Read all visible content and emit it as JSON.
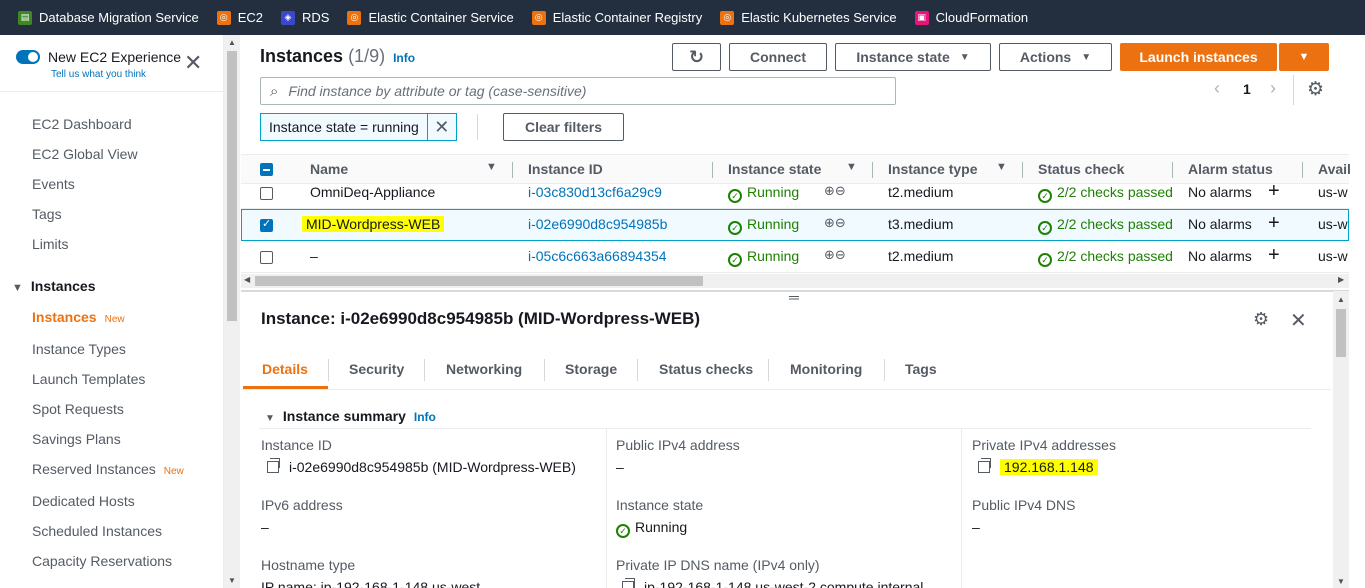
{
  "favorites": [
    {
      "label": "Database Migration Service",
      "color": "#3f8624"
    },
    {
      "label": "EC2",
      "color": "#ec7211"
    },
    {
      "label": "RDS",
      "color": "#3b48cc"
    },
    {
      "label": "Elastic Container Service",
      "color": "#ec7211"
    },
    {
      "label": "Elastic Container Registry",
      "color": "#ec7211"
    },
    {
      "label": "Elastic Kubernetes Service",
      "color": "#ec7211"
    },
    {
      "label": "CloudFormation",
      "color": "#e7157b"
    }
  ],
  "sidebar": {
    "new_experience": "New EC2 Experience",
    "tell_us": "Tell us what you think",
    "items": [
      "EC2 Dashboard",
      "EC2 Global View",
      "Events",
      "Tags",
      "Limits"
    ],
    "section": "Instances",
    "section_items": [
      {
        "label": "Instances",
        "badge": "New"
      },
      {
        "label": "Instance Types",
        "badge": ""
      },
      {
        "label": "Launch Templates",
        "badge": ""
      },
      {
        "label": "Spot Requests",
        "badge": ""
      },
      {
        "label": "Savings Plans",
        "badge": ""
      },
      {
        "label": "Reserved Instances",
        "badge": "New"
      },
      {
        "label": "Dedicated Hosts",
        "badge": ""
      },
      {
        "label": "Scheduled Instances",
        "badge": ""
      },
      {
        "label": "Capacity Reservations",
        "badge": ""
      }
    ]
  },
  "header": {
    "title": "Instances",
    "count": "(1/9)",
    "info": "Info",
    "connect": "Connect",
    "instance_state": "Instance state",
    "actions": "Actions",
    "launch": "Launch instances"
  },
  "search": {
    "placeholder": "Find instance by attribute or tag (case-sensitive)"
  },
  "pager": {
    "page": "1"
  },
  "filter": {
    "token": "Instance state = running",
    "clear": "Clear filters"
  },
  "table": {
    "columns": [
      "Name",
      "Instance ID",
      "Instance state",
      "Instance type",
      "Status check",
      "Alarm status",
      "Avail"
    ],
    "rows": [
      {
        "name": "OmniDeq-Appliance",
        "id": "i-03c830d13cf6a29c9",
        "state": "Running",
        "type": "t2.medium",
        "status": "2/2 checks passed",
        "alarm": "No alarms",
        "az": "us-w",
        "selected": false
      },
      {
        "name": "MID-Wordpress-WEB",
        "id": "i-02e6990d8c954985b",
        "state": "Running",
        "type": "t3.medium",
        "status": "2/2 checks passed",
        "alarm": "No alarms",
        "az": "us-w",
        "selected": true
      },
      {
        "name": "–",
        "id": "i-05c6c663a66894354",
        "state": "Running",
        "type": "t2.medium",
        "status": "2/2 checks passed",
        "alarm": "No alarms",
        "az": "us-w",
        "selected": false
      }
    ]
  },
  "detail": {
    "title": "Instance: i-02e6990d8c954985b (MID-Wordpress-WEB)",
    "tabs": [
      "Details",
      "Security",
      "Networking",
      "Storage",
      "Status checks",
      "Monitoring",
      "Tags"
    ],
    "summary": "Instance summary",
    "summary_info": "Info",
    "fields": {
      "instance_id_label": "Instance ID",
      "instance_id_value": "i-02e6990d8c954985b (MID-Wordpress-WEB)",
      "public_ipv4_label": "Public IPv4 address",
      "public_ipv4_value": "–",
      "private_ipv4_label": "Private IPv4 addresses",
      "private_ipv4_value": "192.168.1.148",
      "ipv6_label": "IPv6 address",
      "ipv6_value": "–",
      "state_label": "Instance state",
      "state_value": "Running",
      "public_dns_label": "Public IPv4 DNS",
      "public_dns_value": "–",
      "hostname_label": "Hostname type",
      "hostname_value": "IP name: ip-192-168-1-148.us-west",
      "private_dns_label": "Private IP DNS name (IPv4 only)",
      "private_dns_value": "ip-192-168-1-148.us-west-2.compute.internal"
    }
  }
}
